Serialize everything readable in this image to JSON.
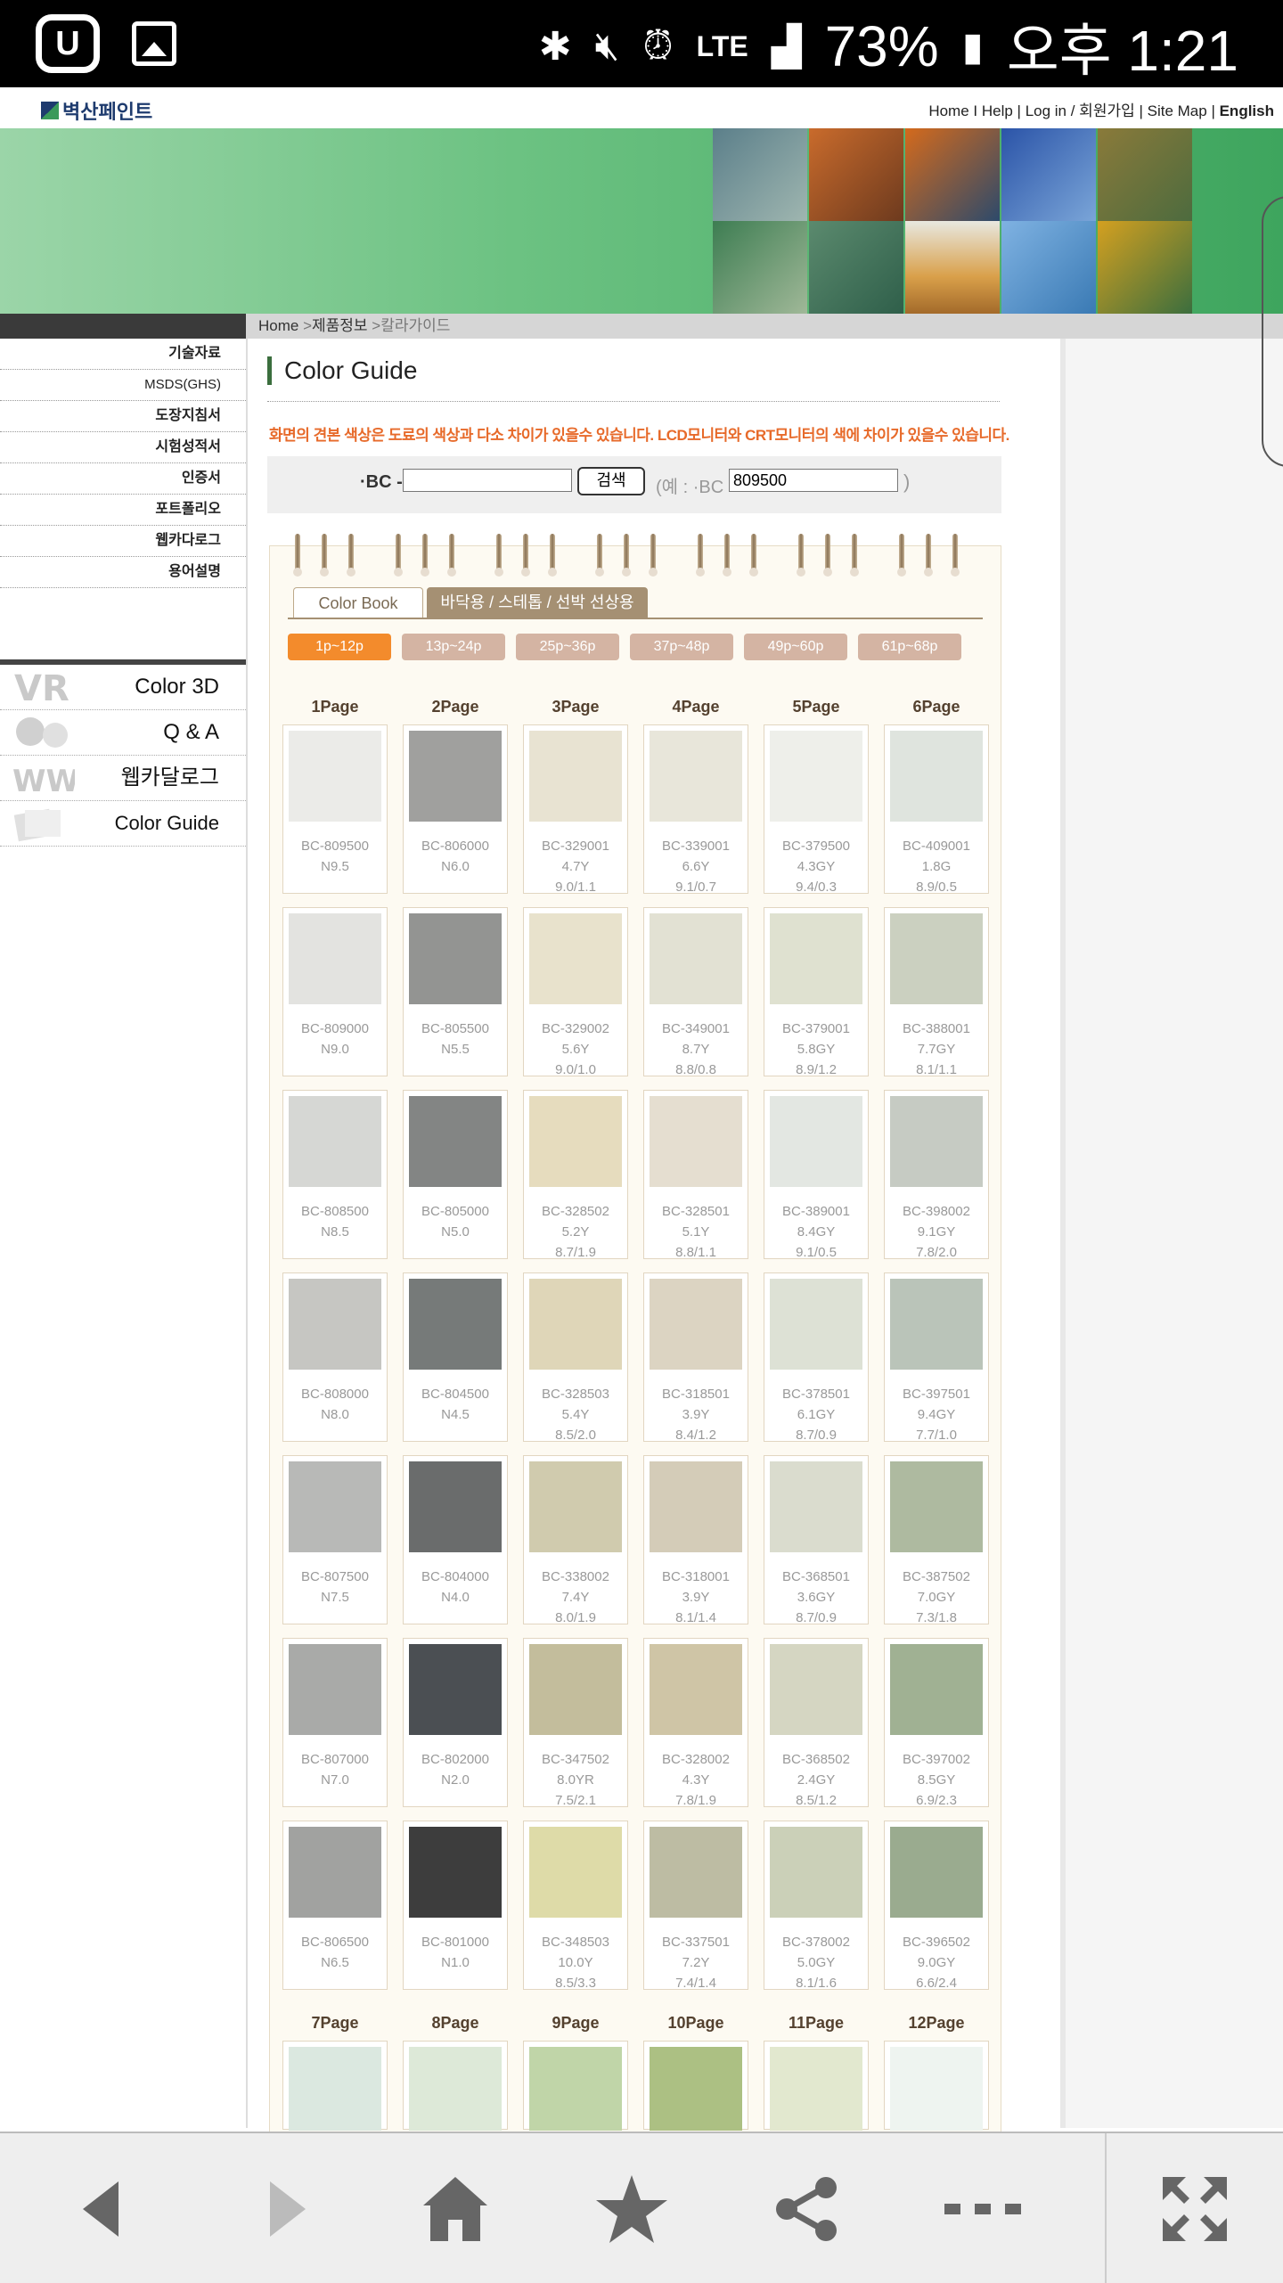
{
  "status": {
    "carrier_icon": "u-plus-icon",
    "image_icon": "gallery-icon",
    "bluetooth": "bluetooth-icon",
    "mute": "mute-icon",
    "alarm": "alarm-icon",
    "network": "LTE",
    "battery": "73%",
    "time": "오후 1:21"
  },
  "site": {
    "logo": "벽산페인트",
    "toplinks": [
      "Home",
      "Help",
      "Log in / 회원가입",
      "Site Map",
      "English"
    ]
  },
  "breadcrumb": {
    "home": "Home",
    "section": "제품정보",
    "current": "칼라가이드"
  },
  "sidebar": {
    "items": [
      "기술자료",
      "MSDS(GHS)",
      "도장지침서",
      "시험성적서",
      "인증서",
      "포트폴리오",
      "웹카다로그",
      "용어설명"
    ],
    "big_items": [
      "Color 3D",
      "Q & A",
      "웹카달로그",
      "Color Guide"
    ]
  },
  "main": {
    "title": "Color Guide",
    "notice": "화면의 견본 색상은 도료의 색상과 다소 차이가 있을수 있습니다. LCD모니터와 CRT모니터의 색에 차이가 있을수 있습니다.",
    "search": {
      "bc_label": "·BC -",
      "button": "검색",
      "example_label": "(예 : ·BC -",
      "example_value": "809500",
      "close_paren": ")"
    },
    "tabs": [
      "Color Book",
      "바닥용 / 스테톱 / 선박 선상용"
    ],
    "page_tabs": [
      "1p~12p",
      "13p~24p",
      "25p~36p",
      "37p~48p",
      "49p~60p",
      "61p~68p"
    ],
    "page_headers_1": [
      "1Page",
      "2Page",
      "3Page",
      "4Page",
      "5Page",
      "6Page"
    ],
    "page_headers_2": [
      "7Page",
      "8Page",
      "9Page",
      "10Page",
      "11Page",
      "12Page"
    ]
  },
  "swatches": [
    [
      {
        "code": "BC-809500",
        "l2": "N9.5",
        "l3": "",
        "color": "#ebebe8"
      },
      {
        "code": "BC-806000",
        "l2": "N6.0",
        "l3": "",
        "color": "#a0a09e"
      },
      {
        "code": "BC-329001",
        "l2": "4.7Y",
        "l3": "9.0/1.1",
        "color": "#e8e3d2"
      },
      {
        "code": "BC-339001",
        "l2": "6.6Y",
        "l3": "9.1/0.7",
        "color": "#e8e6da"
      },
      {
        "code": "BC-379500",
        "l2": "4.3GY",
        "l3": "9.4/0.3",
        "color": "#eeefea"
      },
      {
        "code": "BC-409001",
        "l2": "1.8G",
        "l3": "8.9/0.5",
        "color": "#dfe4de"
      }
    ],
    [
      {
        "code": "BC-809000",
        "l2": "N9.0",
        "l3": "",
        "color": "#e3e3e0"
      },
      {
        "code": "BC-805500",
        "l2": "N5.5",
        "l3": "",
        "color": "#939492"
      },
      {
        "code": "BC-329002",
        "l2": "5.6Y",
        "l3": "9.0/1.0",
        "color": "#e8e2cc"
      },
      {
        "code": "BC-349001",
        "l2": "8.7Y",
        "l3": "8.8/0.8",
        "color": "#e2e1d3"
      },
      {
        "code": "BC-379001",
        "l2": "5.8GY",
        "l3": "8.9/1.2",
        "color": "#dfe1d0"
      },
      {
        "code": "BC-388001",
        "l2": "7.7GY",
        "l3": "8.1/1.1",
        "color": "#cbd0c0"
      }
    ],
    [
      {
        "code": "BC-808500",
        "l2": "N8.5",
        "l3": "",
        "color": "#d6d7d4"
      },
      {
        "code": "BC-805000",
        "l2": "N5.0",
        "l3": "",
        "color": "#838584"
      },
      {
        "code": "BC-328502",
        "l2": "5.2Y",
        "l3": "8.7/1.9",
        "color": "#e6dcbe"
      },
      {
        "code": "BC-328501",
        "l2": "5.1Y",
        "l3": "8.8/1.1",
        "color": "#e5ded0"
      },
      {
        "code": "BC-389001",
        "l2": "8.4GY",
        "l3": "9.1/0.5",
        "color": "#e3e7e2"
      },
      {
        "code": "BC-398002",
        "l2": "9.1GY",
        "l3": "7.8/2.0",
        "color": "#c6cbc3"
      }
    ],
    [
      {
        "code": "BC-808000",
        "l2": "N8.0",
        "l3": "",
        "color": "#c6c6c2"
      },
      {
        "code": "BC-804500",
        "l2": "N4.5",
        "l3": "",
        "color": "#767a79"
      },
      {
        "code": "BC-328503",
        "l2": "5.4Y",
        "l3": "8.5/2.0",
        "color": "#dfd6b8"
      },
      {
        "code": "BC-318501",
        "l2": "3.9Y",
        "l3": "8.4/1.2",
        "color": "#dcd4c2"
      },
      {
        "code": "BC-378501",
        "l2": "6.1GY",
        "l3": "8.7/0.9",
        "color": "#dde1d5"
      },
      {
        "code": "BC-397501",
        "l2": "9.4GY",
        "l3": "7.7/1.0",
        "color": "#bac4b9"
      }
    ],
    [
      {
        "code": "BC-807500",
        "l2": "N7.5",
        "l3": "",
        "color": "#b8b9b7"
      },
      {
        "code": "BC-804000",
        "l2": "N4.0",
        "l3": "",
        "color": "#6a6c6c"
      },
      {
        "code": "BC-338002",
        "l2": "7.4Y",
        "l3": "8.0/1.9",
        "color": "#d0cbae"
      },
      {
        "code": "BC-318001",
        "l2": "3.9Y",
        "l3": "8.1/1.4",
        "color": "#d4ccb8"
      },
      {
        "code": "BC-368501",
        "l2": "3.6GY",
        "l3": "8.7/0.9",
        "color": "#dadcce"
      },
      {
        "code": "BC-387502",
        "l2": "7.0GY",
        "l3": "7.3/1.8",
        "color": "#aebaa0"
      }
    ],
    [
      {
        "code": "BC-807000",
        "l2": "N7.0",
        "l3": "",
        "color": "#a9aaa8"
      },
      {
        "code": "BC-802000",
        "l2": "N2.0",
        "l3": "",
        "color": "#4b4f53"
      },
      {
        "code": "BC-347502",
        "l2": "8.0YR",
        "l3": "7.5/2.1",
        "color": "#c3bd9c"
      },
      {
        "code": "BC-328002",
        "l2": "4.3Y",
        "l3": "7.8/1.9",
        "color": "#cfc5a6"
      },
      {
        "code": "BC-368502",
        "l2": "2.4GY",
        "l3": "8.5/1.2",
        "color": "#d5d6c2"
      },
      {
        "code": "BC-397002",
        "l2": "8.5GY",
        "l3": "6.9/2.3",
        "color": "#a0b193"
      }
    ],
    [
      {
        "code": "BC-806500",
        "l2": "N6.5",
        "l3": "",
        "color": "#a1a2a0"
      },
      {
        "code": "BC-801000",
        "l2": "N1.0",
        "l3": "",
        "color": "#3d3d3d"
      },
      {
        "code": "BC-348503",
        "l2": "10.0Y",
        "l3": "8.5/3.3",
        "color": "#dedba8"
      },
      {
        "code": "BC-337501",
        "l2": "7.2Y",
        "l3": "7.4/1.4",
        "color": "#bdbca3"
      },
      {
        "code": "BC-378002",
        "l2": "5.0GY",
        "l3": "8.1/1.6",
        "color": "#cbd0b8"
      },
      {
        "code": "BC-396502",
        "l2": "9.0GY",
        "l3": "6.6/2.4",
        "color": "#9aab8f"
      }
    ]
  ],
  "partial_swatches": [
    "#dbe8e0",
    "#dde9d8",
    "#c0d5a8",
    "#acc083",
    "#e2e8cf",
    "#eef4f0"
  ],
  "colors": {
    "accent_orange": "#f38b2c",
    "notice_orange": "#e76a2a",
    "tab_brown": "#a59073",
    "brand_green": "#3ea55e"
  },
  "bottomnav": [
    "back-icon",
    "forward-icon",
    "home-icon",
    "bookmark-star-icon",
    "share-icon",
    "more-icon",
    "fullscreen-icon"
  ]
}
